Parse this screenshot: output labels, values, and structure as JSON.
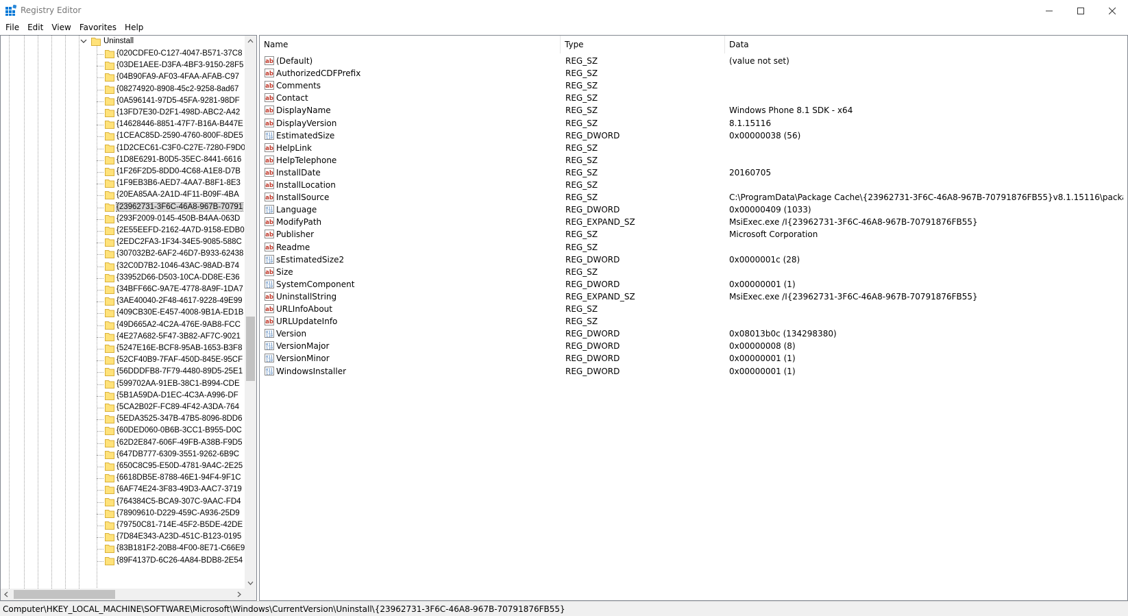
{
  "window": {
    "title": "Registry Editor",
    "accent_color": "#0078d7"
  },
  "menu": [
    "File",
    "Edit",
    "View",
    "Favorites",
    "Help"
  ],
  "tree": {
    "parent_label": "Uninstall",
    "selected_index": 14,
    "items": [
      "{020CDFE0-C127-4047-B571-37C8",
      "{03DE1AEE-D3FA-4BF3-9150-28F5",
      "{04B90FA9-AF03-4FAA-AFAB-C97",
      "{08274920-8908-45c2-9258-8ad67",
      "{0A596141-97D5-45FA-9281-98DF",
      "{13FD7E30-D2F1-498D-ABC2-A42",
      "{14628446-8851-47F7-B16A-B447E",
      "{1CEAC85D-2590-4760-800F-8DE5",
      "{1D2CEC61-C3F0-C27E-7280-F9D0",
      "{1D8E6291-B0D5-35EC-8441-6616",
      "{1F26F2D5-8DD0-4C68-A1E8-D7B",
      "{1F9EB3B6-AED7-4AA7-B8F1-8E3",
      "{20EA85AA-2A1D-4F11-B09F-4BA",
      "{23962731-3F6C-46A8-967B-70791",
      "{293F2009-0145-450B-B4AA-063D",
      "{2E55EEFD-2162-4A7D-9158-EDB0",
      "{2EDC2FA3-1F34-34E5-9085-588C",
      "{307032B2-6AF2-46D7-B933-62438",
      "{32C0D7B2-1046-43AC-98AD-B74",
      "{33952D66-D503-10CA-DD8E-E36",
      "{34BFF66C-9A7E-4778-8A9F-1DA7",
      "{3AE40040-2F48-4617-9228-49E99",
      "{409CB30E-E457-4008-9B1A-ED1B",
      "{49D665A2-4C2A-476E-9AB8-FCC",
      "{4E27A682-5F47-3B82-AF7C-9021",
      "{5247E16E-BCF8-95AB-1653-B3F8",
      "{52CF40B9-7FAF-450D-845E-95CF",
      "{56DDDFB8-7F79-4480-89D5-25E1",
      "{599702AA-91EB-38C1-B994-CDE",
      "{5B1A59DA-D1EC-4C3A-A996-DF",
      "{5CA2B02F-FC89-4F42-A3DA-764",
      "{5EDA3525-347B-47B5-8096-8DD6",
      "{60DED060-0B6B-3CC1-B955-D0C",
      "{62D2E847-606F-49FB-A38B-F9D5",
      "{647DB777-6309-3551-9262-6B9C",
      "{650C8C95-E50D-4781-9A4C-2E25",
      "{6618DB5E-8788-46E1-94F4-9F1C",
      "{6AF74E24-3F83-49D3-AAC7-3719",
      "{764384C5-BCA9-307C-9AAC-FD4",
      "{78909610-D229-459C-A936-25D9",
      "{79750C81-714E-45F2-B5DE-42DE",
      "{7D84E343-A23D-451C-B123-0195",
      "{83B181F2-20B8-4F00-8E71-C66E9",
      "{89F4137D-6C26-4A84-BDB8-2E54"
    ]
  },
  "columns": {
    "name": "Name",
    "type": "Type",
    "data": "Data"
  },
  "values": [
    {
      "name": "(Default)",
      "type": "REG_SZ",
      "data": "(value not set)",
      "icon": "string-value-icon"
    },
    {
      "name": "AuthorizedCDFPrefix",
      "type": "REG_SZ",
      "data": "",
      "icon": "string-value-icon"
    },
    {
      "name": "Comments",
      "type": "REG_SZ",
      "data": "",
      "icon": "string-value-icon"
    },
    {
      "name": "Contact",
      "type": "REG_SZ",
      "data": "",
      "icon": "string-value-icon"
    },
    {
      "name": "DisplayName",
      "type": "REG_SZ",
      "data": "Windows Phone 8.1 SDK - x64",
      "icon": "string-value-icon"
    },
    {
      "name": "DisplayVersion",
      "type": "REG_SZ",
      "data": "8.1.15116",
      "icon": "string-value-icon"
    },
    {
      "name": "EstimatedSize",
      "type": "REG_DWORD",
      "data": "0x00000038 (56)",
      "icon": "binary-value-icon"
    },
    {
      "name": "HelpLink",
      "type": "REG_SZ",
      "data": "",
      "icon": "string-value-icon"
    },
    {
      "name": "HelpTelephone",
      "type": "REG_SZ",
      "data": "",
      "icon": "string-value-icon"
    },
    {
      "name": "InstallDate",
      "type": "REG_SZ",
      "data": "20160705",
      "icon": "string-value-icon"
    },
    {
      "name": "InstallLocation",
      "type": "REG_SZ",
      "data": "",
      "icon": "string-value-icon"
    },
    {
      "name": "InstallSource",
      "type": "REG_SZ",
      "data": "C:\\ProgramData\\Package Cache\\{23962731-3F6C-46A8-967B-70791876FB55}v8.1.15116\\packages\\Windo...",
      "icon": "string-value-icon"
    },
    {
      "name": "Language",
      "type": "REG_DWORD",
      "data": "0x00000409 (1033)",
      "icon": "binary-value-icon"
    },
    {
      "name": "ModifyPath",
      "type": "REG_EXPAND_SZ",
      "data": "MsiExec.exe /I{23962731-3F6C-46A8-967B-70791876FB55}",
      "icon": "string-value-icon"
    },
    {
      "name": "Publisher",
      "type": "REG_SZ",
      "data": "Microsoft Corporation",
      "icon": "string-value-icon"
    },
    {
      "name": "Readme",
      "type": "REG_SZ",
      "data": "",
      "icon": "string-value-icon"
    },
    {
      "name": "sEstimatedSize2",
      "type": "REG_DWORD",
      "data": "0x0000001c (28)",
      "icon": "binary-value-icon"
    },
    {
      "name": "Size",
      "type": "REG_SZ",
      "data": "",
      "icon": "string-value-icon"
    },
    {
      "name": "SystemComponent",
      "type": "REG_DWORD",
      "data": "0x00000001 (1)",
      "icon": "binary-value-icon"
    },
    {
      "name": "UninstallString",
      "type": "REG_EXPAND_SZ",
      "data": "MsiExec.exe /I{23962731-3F6C-46A8-967B-70791876FB55}",
      "icon": "string-value-icon"
    },
    {
      "name": "URLInfoAbout",
      "type": "REG_SZ",
      "data": "",
      "icon": "string-value-icon"
    },
    {
      "name": "URLUpdateInfo",
      "type": "REG_SZ",
      "data": "",
      "icon": "string-value-icon"
    },
    {
      "name": "Version",
      "type": "REG_DWORD",
      "data": "0x08013b0c (134298380)",
      "icon": "binary-value-icon"
    },
    {
      "name": "VersionMajor",
      "type": "REG_DWORD",
      "data": "0x00000008 (8)",
      "icon": "binary-value-icon"
    },
    {
      "name": "VersionMinor",
      "type": "REG_DWORD",
      "data": "0x00000001 (1)",
      "icon": "binary-value-icon"
    },
    {
      "name": "WindowsInstaller",
      "type": "REG_DWORD",
      "data": "0x00000001 (1)",
      "icon": "binary-value-icon"
    }
  ],
  "status": {
    "path": "Computer\\HKEY_LOCAL_MACHINE\\SOFTWARE\\Microsoft\\Windows\\CurrentVersion\\Uninstall\\{23962731-3F6C-46A8-967B-70791876FB55}"
  }
}
